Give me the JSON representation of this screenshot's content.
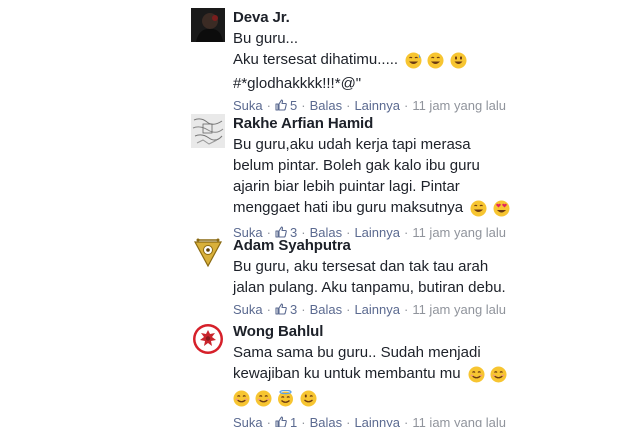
{
  "comments": [
    {
      "author": "Deva Jr.",
      "lines": [
        "Bu guru...",
        "Aku tersesat dihatimu.....",
        "#*glodhakkkk!!!*@\""
      ],
      "like_label": "Suka",
      "likes": "5",
      "reply_label": "Balas",
      "more_label": "Lainnya",
      "time": "11 jam yang lalu"
    },
    {
      "author": "Rakhe Arfian Hamid",
      "lines": [
        "Bu guru,aku udah kerja tapi merasa",
        "belum pintar. Boleh gak kalo ibu guru",
        "ajarin biar lebih puintar lagi. Pintar",
        "menggaet hati ibu guru maksutnya"
      ],
      "like_label": "Suka",
      "likes": "3",
      "reply_label": "Balas",
      "more_label": "Lainnya",
      "time": "11 jam yang lalu"
    },
    {
      "author": "Adam Syahputra",
      "lines": [
        "Bu guru, aku tersesat dan tak tau arah",
        "jalan pulang. Aku tanpamu, butiran debu."
      ],
      "like_label": "Suka",
      "likes": "3",
      "reply_label": "Balas",
      "more_label": "Lainnya",
      "time": "11 jam yang lalu"
    },
    {
      "author": "Wong Bahlul",
      "lines": [
        "Sama sama bu guru.. Sudah menjadi",
        "kewajiban ku untuk membantu mu"
      ],
      "like_label": "Suka",
      "likes": "1",
      "reply_label": "Balas",
      "more_label": "Lainnya",
      "time": "11 jam yang lalu"
    }
  ],
  "colors": {
    "text": "#1d2129",
    "link": "#5b6a90",
    "muted": "#90949c",
    "emoji_yellow": "#f7c531"
  },
  "icons": {
    "like": "thumbs-up-icon",
    "emoji": "smiling-face-emoji"
  }
}
